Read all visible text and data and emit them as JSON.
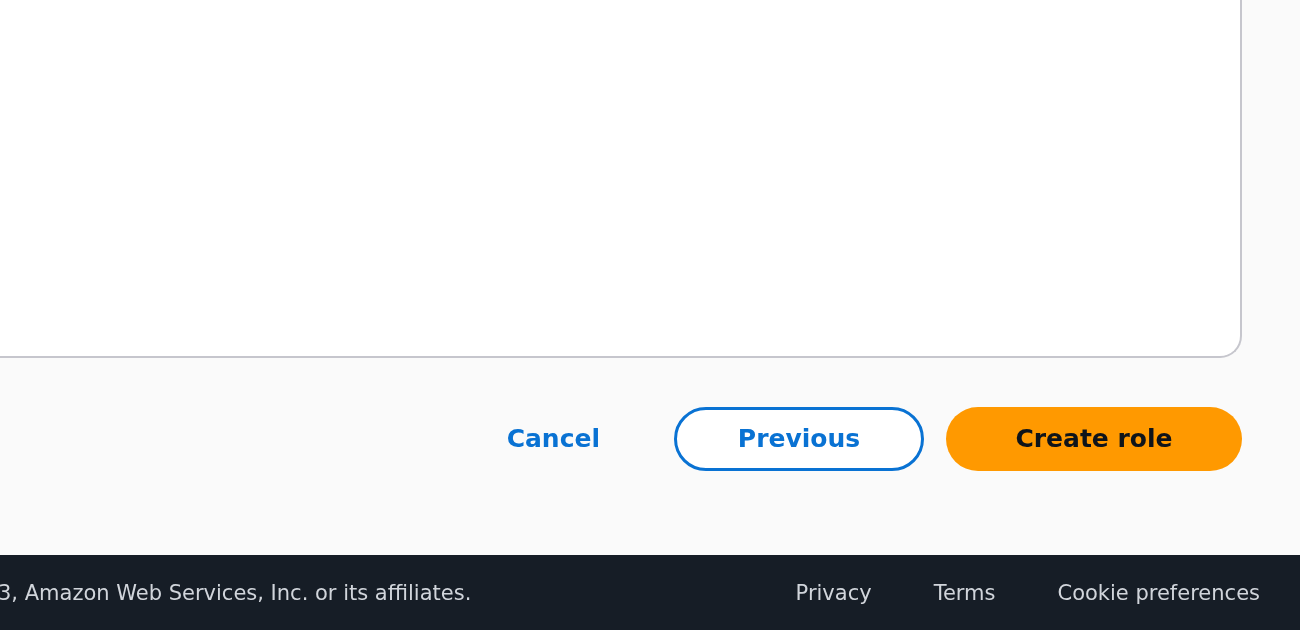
{
  "actions": {
    "cancel": "Cancel",
    "previous": "Previous",
    "primary": "Create role"
  },
  "footer": {
    "copyright": "3, Amazon Web Services, Inc. or its affiliates.",
    "links": [
      "Privacy",
      "Terms",
      "Cookie preferences"
    ]
  }
}
